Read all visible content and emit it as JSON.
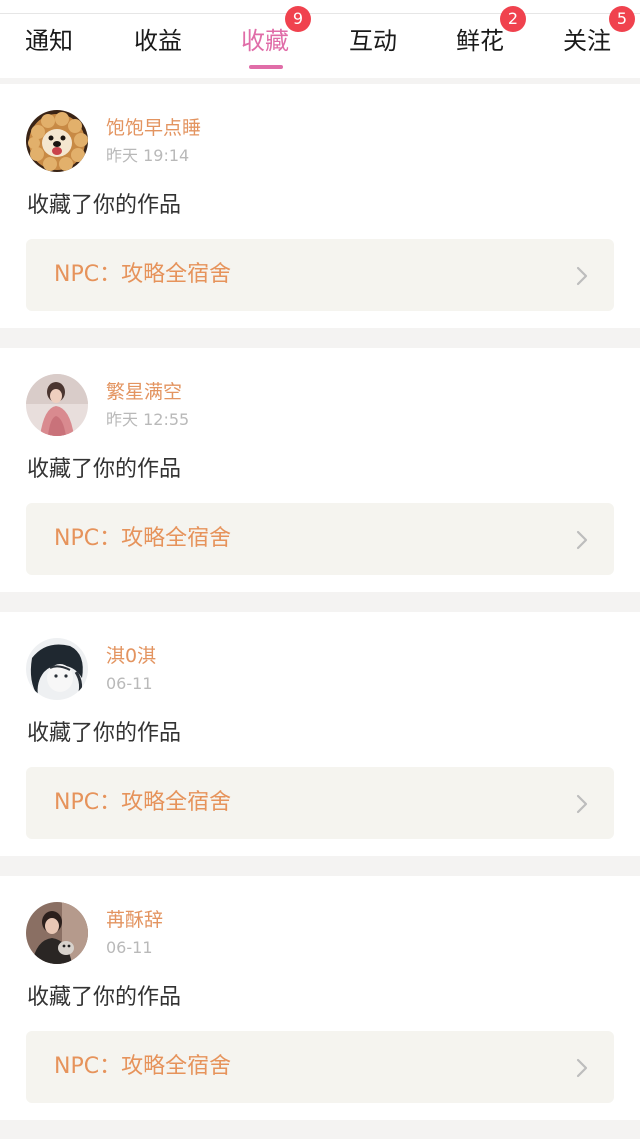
{
  "colors": {
    "accent": "#e06da8",
    "badge": "#f0424e",
    "username": "#e39460",
    "work_title": "#e6935b"
  },
  "tabs": [
    {
      "label": "通知",
      "badge": null,
      "active": false
    },
    {
      "label": "收益",
      "badge": null,
      "active": false
    },
    {
      "label": "收藏",
      "badge": "9",
      "active": true
    },
    {
      "label": "互动",
      "badge": null,
      "active": false
    },
    {
      "label": "鲜花",
      "badge": "2",
      "active": false
    },
    {
      "label": "关注",
      "badge": "5",
      "active": false
    }
  ],
  "notifications": [
    {
      "user": "饱饱早点睡",
      "time": "昨天 19:14",
      "action": "收藏了你的作品",
      "work": "NPC：攻略全宿舍",
      "avatar_icon": "dog-avatar-icon"
    },
    {
      "user": "繁星满空",
      "time": "昨天 12:55",
      "action": "收藏了你的作品",
      "work": "NPC：攻略全宿舍",
      "avatar_icon": "girl-photo-avatar-icon"
    },
    {
      "user": "淇0淇",
      "time": "06-11",
      "action": "收藏了你的作品",
      "work": "NPC：攻略全宿舍",
      "avatar_icon": "sketch-face-avatar-icon"
    },
    {
      "user": "苒酥辞",
      "time": "06-11",
      "action": "收藏了你的作品",
      "work": "NPC：攻略全宿舍",
      "avatar_icon": "person-photo-avatar-icon"
    }
  ]
}
